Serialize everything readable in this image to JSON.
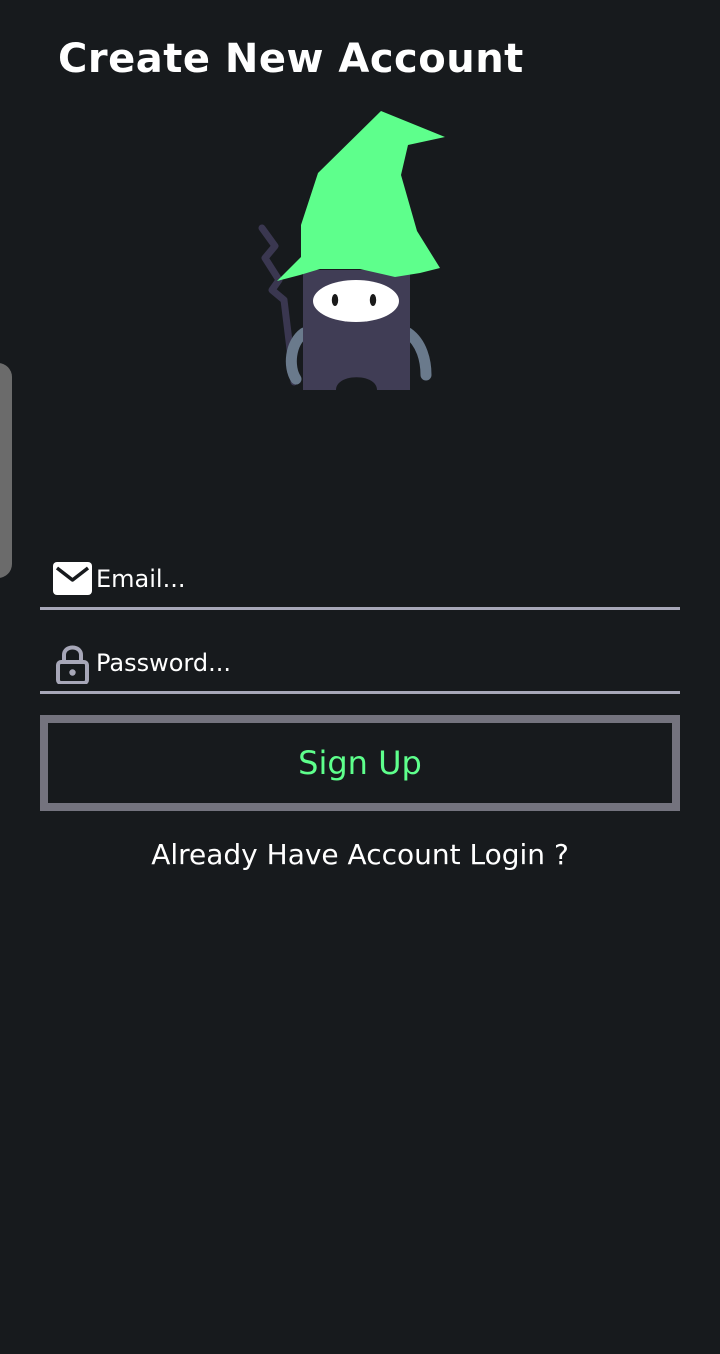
{
  "header": {
    "title": "Create New Account"
  },
  "form": {
    "email": {
      "placeholder": "Email...",
      "value": "",
      "icon": "envelope-icon"
    },
    "password": {
      "placeholder": "Password...",
      "value": "",
      "icon": "lock-icon"
    },
    "signup_label": "Sign Up",
    "login_prompt": "Already Have Account Login ?"
  },
  "colors": {
    "background": "#171a1d",
    "accent": "#5eff8c",
    "button_border": "#74737e",
    "field_underline": "#a7a7b8"
  }
}
